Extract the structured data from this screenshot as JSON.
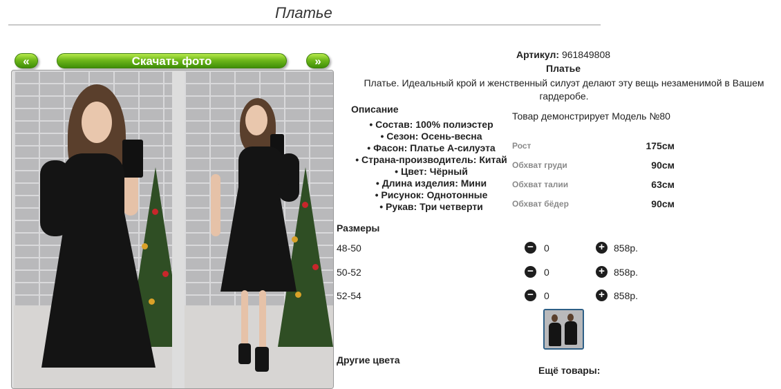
{
  "product": {
    "title": "Платье",
    "article_label": "Артикул:",
    "article_value": "961849808",
    "name": "Платье",
    "short_description": "Платье. Идеальный крой и женственный силуэт делают эту вещь незаменимой в Вашем гардеробе."
  },
  "gallery": {
    "prev_label": "«",
    "next_label": "»",
    "download_label": "Скачать фото"
  },
  "description": {
    "heading": "Описание",
    "items": [
      "Состав: 100% полиэстер",
      "Сезон: Осень-весна",
      "Фасон: Платье А-силуэта",
      "Страна-производитель: Китай",
      "Цвет: Чёрный",
      "Длина изделия: Мини",
      "Рисунок: Однотонные",
      "Рукав: Три четверти"
    ]
  },
  "model": {
    "caption": "Товар демонстрирует Модель №80",
    "measurements": [
      {
        "label": "Рост",
        "value": "175см"
      },
      {
        "label": "Обхват груди",
        "value": "90см"
      },
      {
        "label": "Обхват талии",
        "value": "63см"
      },
      {
        "label": "Обхват бёдер",
        "value": "90см"
      }
    ]
  },
  "sizes": {
    "heading": "Размеры",
    "rows": [
      {
        "size": "48-50",
        "qty": "0",
        "price": "858р."
      },
      {
        "size": "50-52",
        "qty": "0",
        "price": "858р."
      },
      {
        "size": "52-54",
        "qty": "0",
        "price": "858р."
      }
    ]
  },
  "other_colors_heading": "Другие цвета",
  "more_products_heading": "Ещё товары:",
  "colors": {
    "button_green": "#6fb81b",
    "dress": "#141414",
    "thumb_border": "#2d5f86"
  }
}
